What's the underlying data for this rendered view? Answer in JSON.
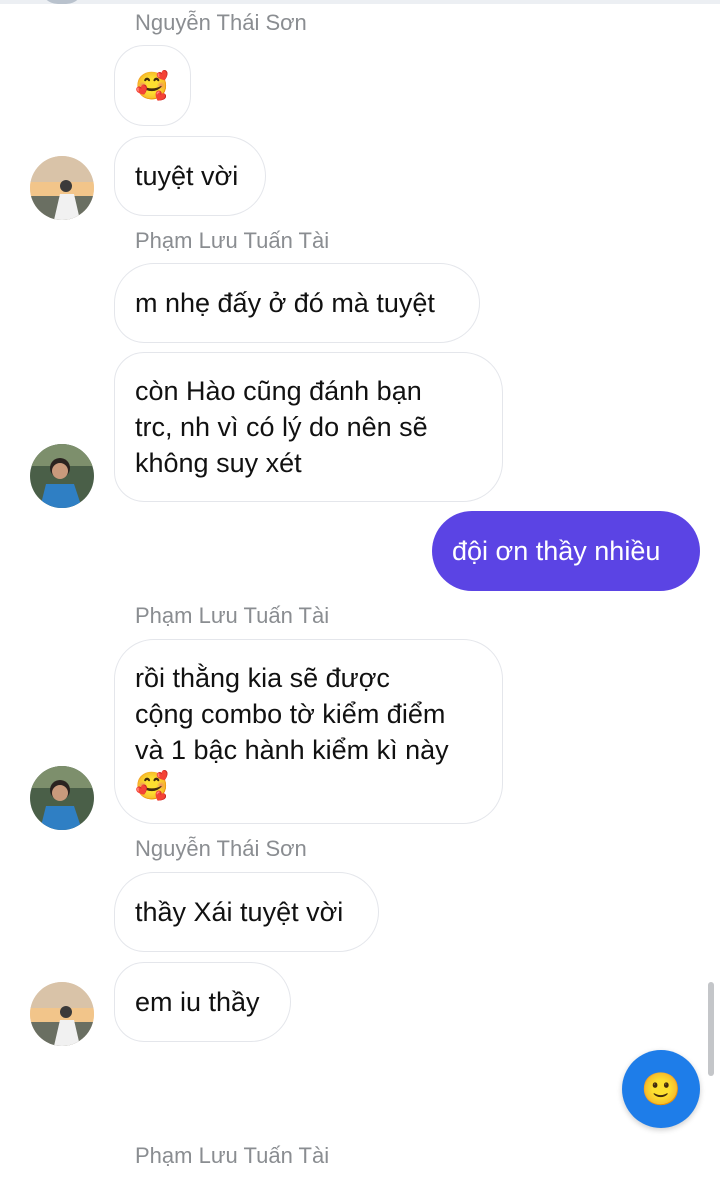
{
  "conversation": {
    "messages": [
      {
        "sender": "Nguyễn Thái Sơn",
        "text": "🥰",
        "direction": "incoming"
      },
      {
        "sender": "Nguyễn Thái Sơn",
        "text": "tuyệt vời",
        "direction": "incoming"
      },
      {
        "sender": "Phạm Lưu Tuấn Tài",
        "text": "m nhẹ đấy ở đó mà tuyệt",
        "direction": "incoming"
      },
      {
        "sender": "Phạm Lưu Tuấn Tài",
        "text": "còn Hào cũng đánh bạn\ntrc, nh vì có lý do nên sẽ\nkhông suy xét",
        "direction": "incoming"
      },
      {
        "sender": "me",
        "text": "đội ơn thầy nhiều",
        "direction": "outgoing"
      },
      {
        "sender": "Phạm Lưu Tuấn Tài",
        "text": "rồi thằng kia sẽ được\ncộng combo tờ kiểm điểm\nvà 1 bậc hành kiểm kì này\n🥰",
        "direction": "incoming"
      },
      {
        "sender": "Nguyễn Thái Sơn",
        "text": "thầy Xái tuyệt vời",
        "direction": "incoming"
      },
      {
        "sender": "Nguyễn Thái Sơn",
        "text": "em iu thầy",
        "direction": "incoming"
      }
    ],
    "sender_labels": [
      "Nguyễn Thái Sơn",
      "Phạm Lưu Tuấn Tài",
      "Phạm Lưu Tuấn Tài",
      "Nguyễn Thái Sơn",
      "Phạm Lưu Tuấn Tài"
    ],
    "quick_reaction": {
      "icon": "smiley-icon",
      "glyph": "🙂"
    }
  },
  "colors": {
    "outgoing_bubble": "#5b44e4",
    "incoming_border": "#e4e6eb",
    "sender_text": "#8a8d91",
    "fab": "#1e7de9"
  }
}
